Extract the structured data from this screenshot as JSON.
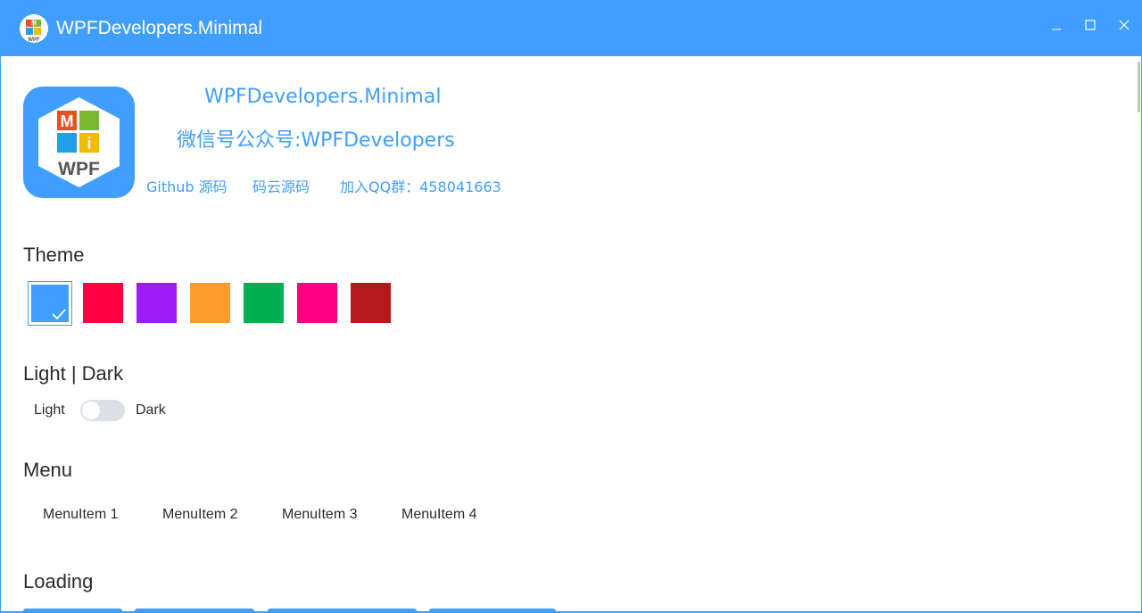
{
  "window": {
    "title": "WPFDevelopers.Minimal",
    "controls": [
      "minimize-icon",
      "maximize-icon",
      "close-icon"
    ],
    "accent_color": "#409eff"
  },
  "header": {
    "title": "WPFDevelopers.Minimal",
    "subtitle": "微信号公众号:WPFDevelopers",
    "logo_letters": [
      "M",
      "i",
      "WPF"
    ],
    "links": [
      {
        "label": "Github 源码"
      },
      {
        "label": "码云源码"
      },
      {
        "label": "加入QQ群：458041663"
      }
    ]
  },
  "theme": {
    "heading": "Theme",
    "swatches": [
      {
        "color": "#409eff",
        "selected": true
      },
      {
        "color": "#ff0040"
      },
      {
        "color": "#9d1cf7"
      },
      {
        "color": "#ff9b2f"
      },
      {
        "color": "#00b050"
      },
      {
        "color": "#ff0080"
      },
      {
        "color": "#b4191c"
      }
    ]
  },
  "mode": {
    "heading": "Light | Dark",
    "light_label": "Light",
    "dark_label": "Dark",
    "dark_enabled": false
  },
  "menu": {
    "heading": "Menu",
    "items": [
      "MenuItem 1",
      "MenuItem 2",
      "MenuItem 3",
      "MenuItem 4"
    ]
  },
  "loading": {
    "heading": "Loading"
  }
}
